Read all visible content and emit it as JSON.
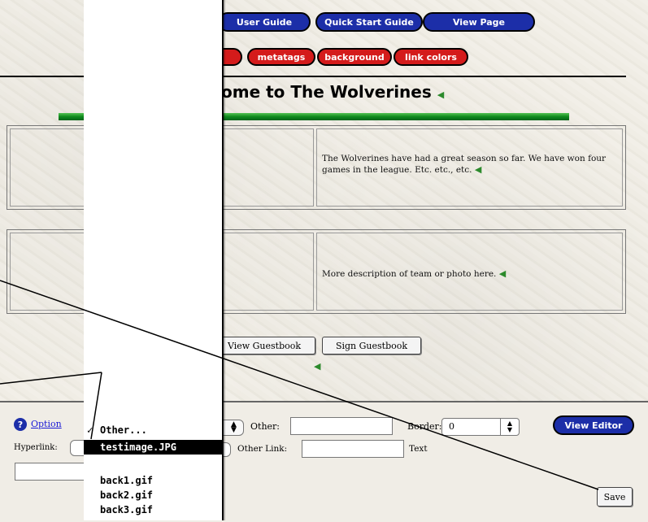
{
  "nav": {
    "user_guide": "User Guide",
    "quick_start": "Quick Start Guide",
    "view_page": "View Page"
  },
  "subnav": {
    "metatags": "metatags",
    "background": "background",
    "link_colors": "link colors"
  },
  "page": {
    "title_visible": "ome to The Wolverines",
    "row1_text": "The Wolverines have had a great season so far. We have won four games in the league. Etc. etc., etc.",
    "row2_text": "More description of team or photo here.",
    "view_guestbook": "View Guestbook",
    "sign_guestbook": "Sign Guestbook"
  },
  "toolbar": {
    "options_link": "Option",
    "hyperlink_label": "Hyperlink:",
    "other_label": "Other:",
    "other_link_label": "Other Link:",
    "border_label": "Border:",
    "border_value": "0",
    "text_label": "Text",
    "view_editor": "View Editor",
    "save": "Save"
  },
  "dropdown": {
    "items": [
      {
        "label": "Other...",
        "checked": true,
        "selected": false
      },
      {
        "label": "testimage.JPG",
        "checked": false,
        "selected": true
      },
      {
        "label": "",
        "checked": false,
        "selected": false
      },
      {
        "label": "back1.gif",
        "checked": false,
        "selected": false
      },
      {
        "label": "back2.gif",
        "checked": false,
        "selected": false
      },
      {
        "label": "back3.gif",
        "checked": false,
        "selected": false
      }
    ]
  },
  "colors": {
    "nav_blue": "#1c2ea8",
    "tab_red": "#d41b1b",
    "rule_green": "#0e8a1c"
  }
}
